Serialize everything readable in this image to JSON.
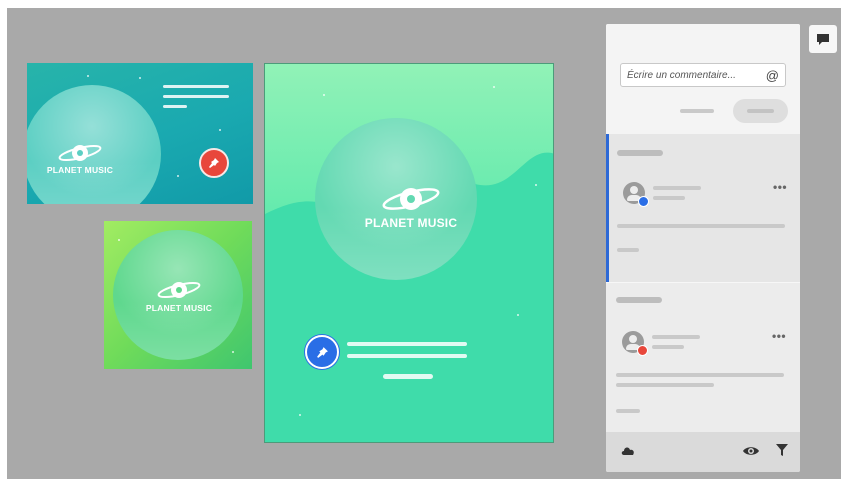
{
  "canvas": {
    "background": "#a9a9a9",
    "artboards": {
      "banner": {
        "brand": "PLANET MUSIC",
        "pin_color": "#e8473b"
      },
      "square": {
        "brand": "PLANET MUSIC"
      },
      "poster": {
        "brand": "PLANET MUSIC",
        "pin_color": "#2a6ee6"
      }
    }
  },
  "comments_panel": {
    "input": {
      "placeholder": "Écrire un commentaire...",
      "mention_icon": "@"
    },
    "threads": [
      {
        "selected": true,
        "badge_color": "#2a6ee6",
        "menu": "•••"
      },
      {
        "selected": false,
        "badge_color": "#e8473b",
        "menu": "•••"
      }
    ],
    "footer_icons": [
      "cloud-icon",
      "visibility-icon",
      "filter-icon"
    ]
  },
  "chat_toggle_icon": "comment-icon",
  "colors": {
    "accent_blue": "#2d69d6",
    "pin_red": "#e8473b"
  }
}
